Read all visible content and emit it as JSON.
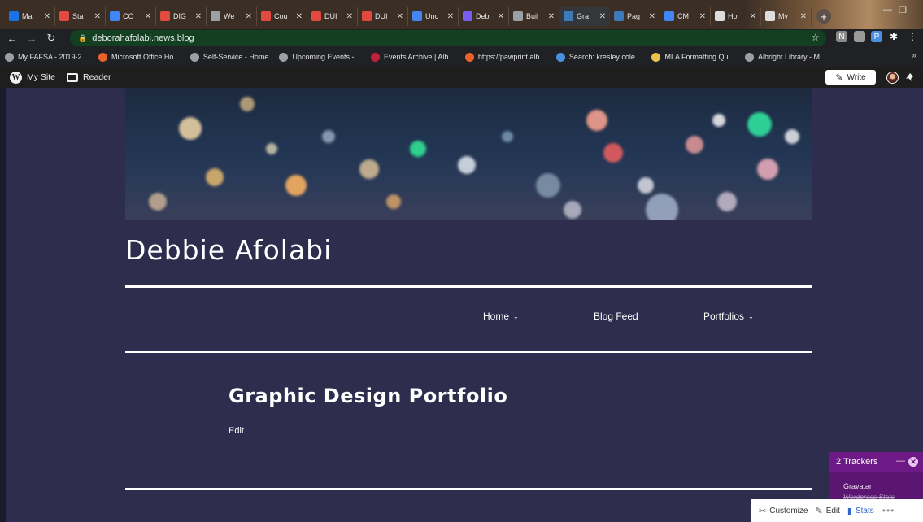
{
  "browser": {
    "tabs": [
      {
        "label": "Mai",
        "color": "#1a73e8"
      },
      {
        "label": "Sta",
        "color": "#e04a3f"
      },
      {
        "label": "CO",
        "color": "#4285f4"
      },
      {
        "label": "DIG",
        "color": "#e04a3f"
      },
      {
        "label": "We",
        "color": "#9aa0a6"
      },
      {
        "label": "Cou",
        "color": "#e04a3f"
      },
      {
        "label": "DUI",
        "color": "#e04a3f"
      },
      {
        "label": "DUI",
        "color": "#e04a3f"
      },
      {
        "label": "Unc",
        "color": "#4285f4"
      },
      {
        "label": "Deb",
        "color": "#7b5cf0"
      },
      {
        "label": "Buil",
        "color": "#9aa0a6"
      },
      {
        "label": "Gra",
        "color": "#3d7ab8",
        "active": true
      },
      {
        "label": "Pag",
        "color": "#3d7ab8"
      },
      {
        "label": "CM",
        "color": "#4285f4"
      },
      {
        "label": "Hor",
        "color": "#dddddd"
      },
      {
        "label": "My",
        "color": "#dddddd"
      }
    ],
    "new_tab": "+",
    "url": "deborahafolabi.news.blog",
    "bookmarks": [
      {
        "label": "My FAFSA - 2019-2...",
        "color": "#9aa0a6"
      },
      {
        "label": "Microsoft Office Ho...",
        "color": "#e8622a"
      },
      {
        "label": "Self-Service - Home",
        "color": "#9aa0a6"
      },
      {
        "label": "Upcoming Events -...",
        "color": "#9aa0a6"
      },
      {
        "label": "Events Archive | Alb...",
        "color": "#c0213a"
      },
      {
        "label": "https://pawprint.alb...",
        "color": "#e8622a"
      },
      {
        "label": "Search: kresley cole...",
        "color": "#4a8fe0"
      },
      {
        "label": "MLA Formatting Qu...",
        "color": "#e8c34a"
      },
      {
        "label": "Albright Library - M...",
        "color": "#9aa0a6"
      }
    ],
    "bookmarks_more": "»"
  },
  "wp_admin": {
    "my_site": "My Site",
    "reader": "Reader",
    "write": "Write"
  },
  "site": {
    "title": "Debbie Afolabi",
    "nav": [
      {
        "label": "Home",
        "dropdown": true
      },
      {
        "label": "Blog Feed",
        "dropdown": false
      },
      {
        "label": "Portfolios",
        "dropdown": true
      }
    ],
    "page_title": "Graphic Design Portfolio",
    "edit": "Edit"
  },
  "tracker": {
    "title": "2 Trackers",
    "items": [
      "Gravatar",
      "Wordpress Stats"
    ]
  },
  "action_bar": {
    "customize": "Customize",
    "edit": "Edit",
    "stats": "Stats"
  },
  "colors": {
    "site_background": "#2e2d4d",
    "tracker_purple": "#6d1a86",
    "admin_bar": "#1e1e1e",
    "address_bar_fill": "#124021"
  }
}
